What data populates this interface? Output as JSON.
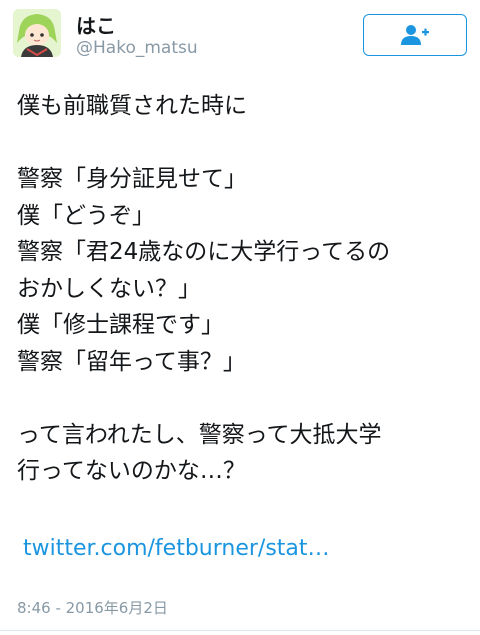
{
  "user": {
    "display_name": "はこ",
    "handle": "@Hako_matsu",
    "avatar_icon": "avatar-illustration"
  },
  "follow_button": {
    "icon": "add-user-icon",
    "color": "#1b95e0"
  },
  "tweet": {
    "lines": [
      "僕も前職質された時に",
      "",
      "警察「身分証見せて」",
      "僕「どうぞ」",
      "警察「君24歳なのに大学行ってるの",
      "おかしくない？」",
      "僕「修士課程です」",
      "警察「留年って事？」",
      "",
      "って言われたし、警察って大抵大学",
      "行ってないのかな…？"
    ],
    "link": "twitter.com/fetburner/stat…",
    "timestamp": "8:46 - 2016年6月2日"
  },
  "colors": {
    "text": "#14171a",
    "muted": "#8899a6",
    "link": "#1b95e0"
  }
}
